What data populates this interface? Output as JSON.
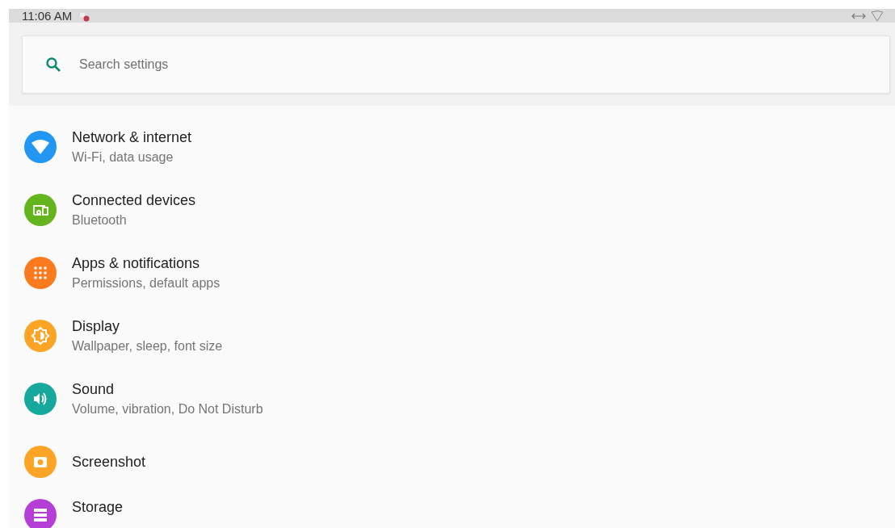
{
  "status_bar": {
    "time": "11:06 AM"
  },
  "search": {
    "placeholder": "Search settings"
  },
  "items": [
    {
      "kind": "wifi",
      "color": "#2196f3",
      "title": "Network & internet",
      "subtitle": "Wi-Fi, data usage"
    },
    {
      "kind": "devices",
      "color": "#64b41e",
      "title": "Connected devices",
      "subtitle": "Bluetooth"
    },
    {
      "kind": "apps",
      "color": "#fb7a1d",
      "title": "Apps & notifications",
      "subtitle": "Permissions, default apps"
    },
    {
      "kind": "display",
      "color": "#fba425",
      "title": "Display",
      "subtitle": "Wallpaper, sleep, font size"
    },
    {
      "kind": "sound",
      "color": "#16a89c",
      "title": "Sound",
      "subtitle": "Volume, vibration, Do Not Disturb"
    },
    {
      "kind": "camera",
      "color": "#fba425",
      "title": "Screenshot"
    },
    {
      "kind": "storage",
      "color": "#b53fd6",
      "title": "Storage"
    }
  ]
}
